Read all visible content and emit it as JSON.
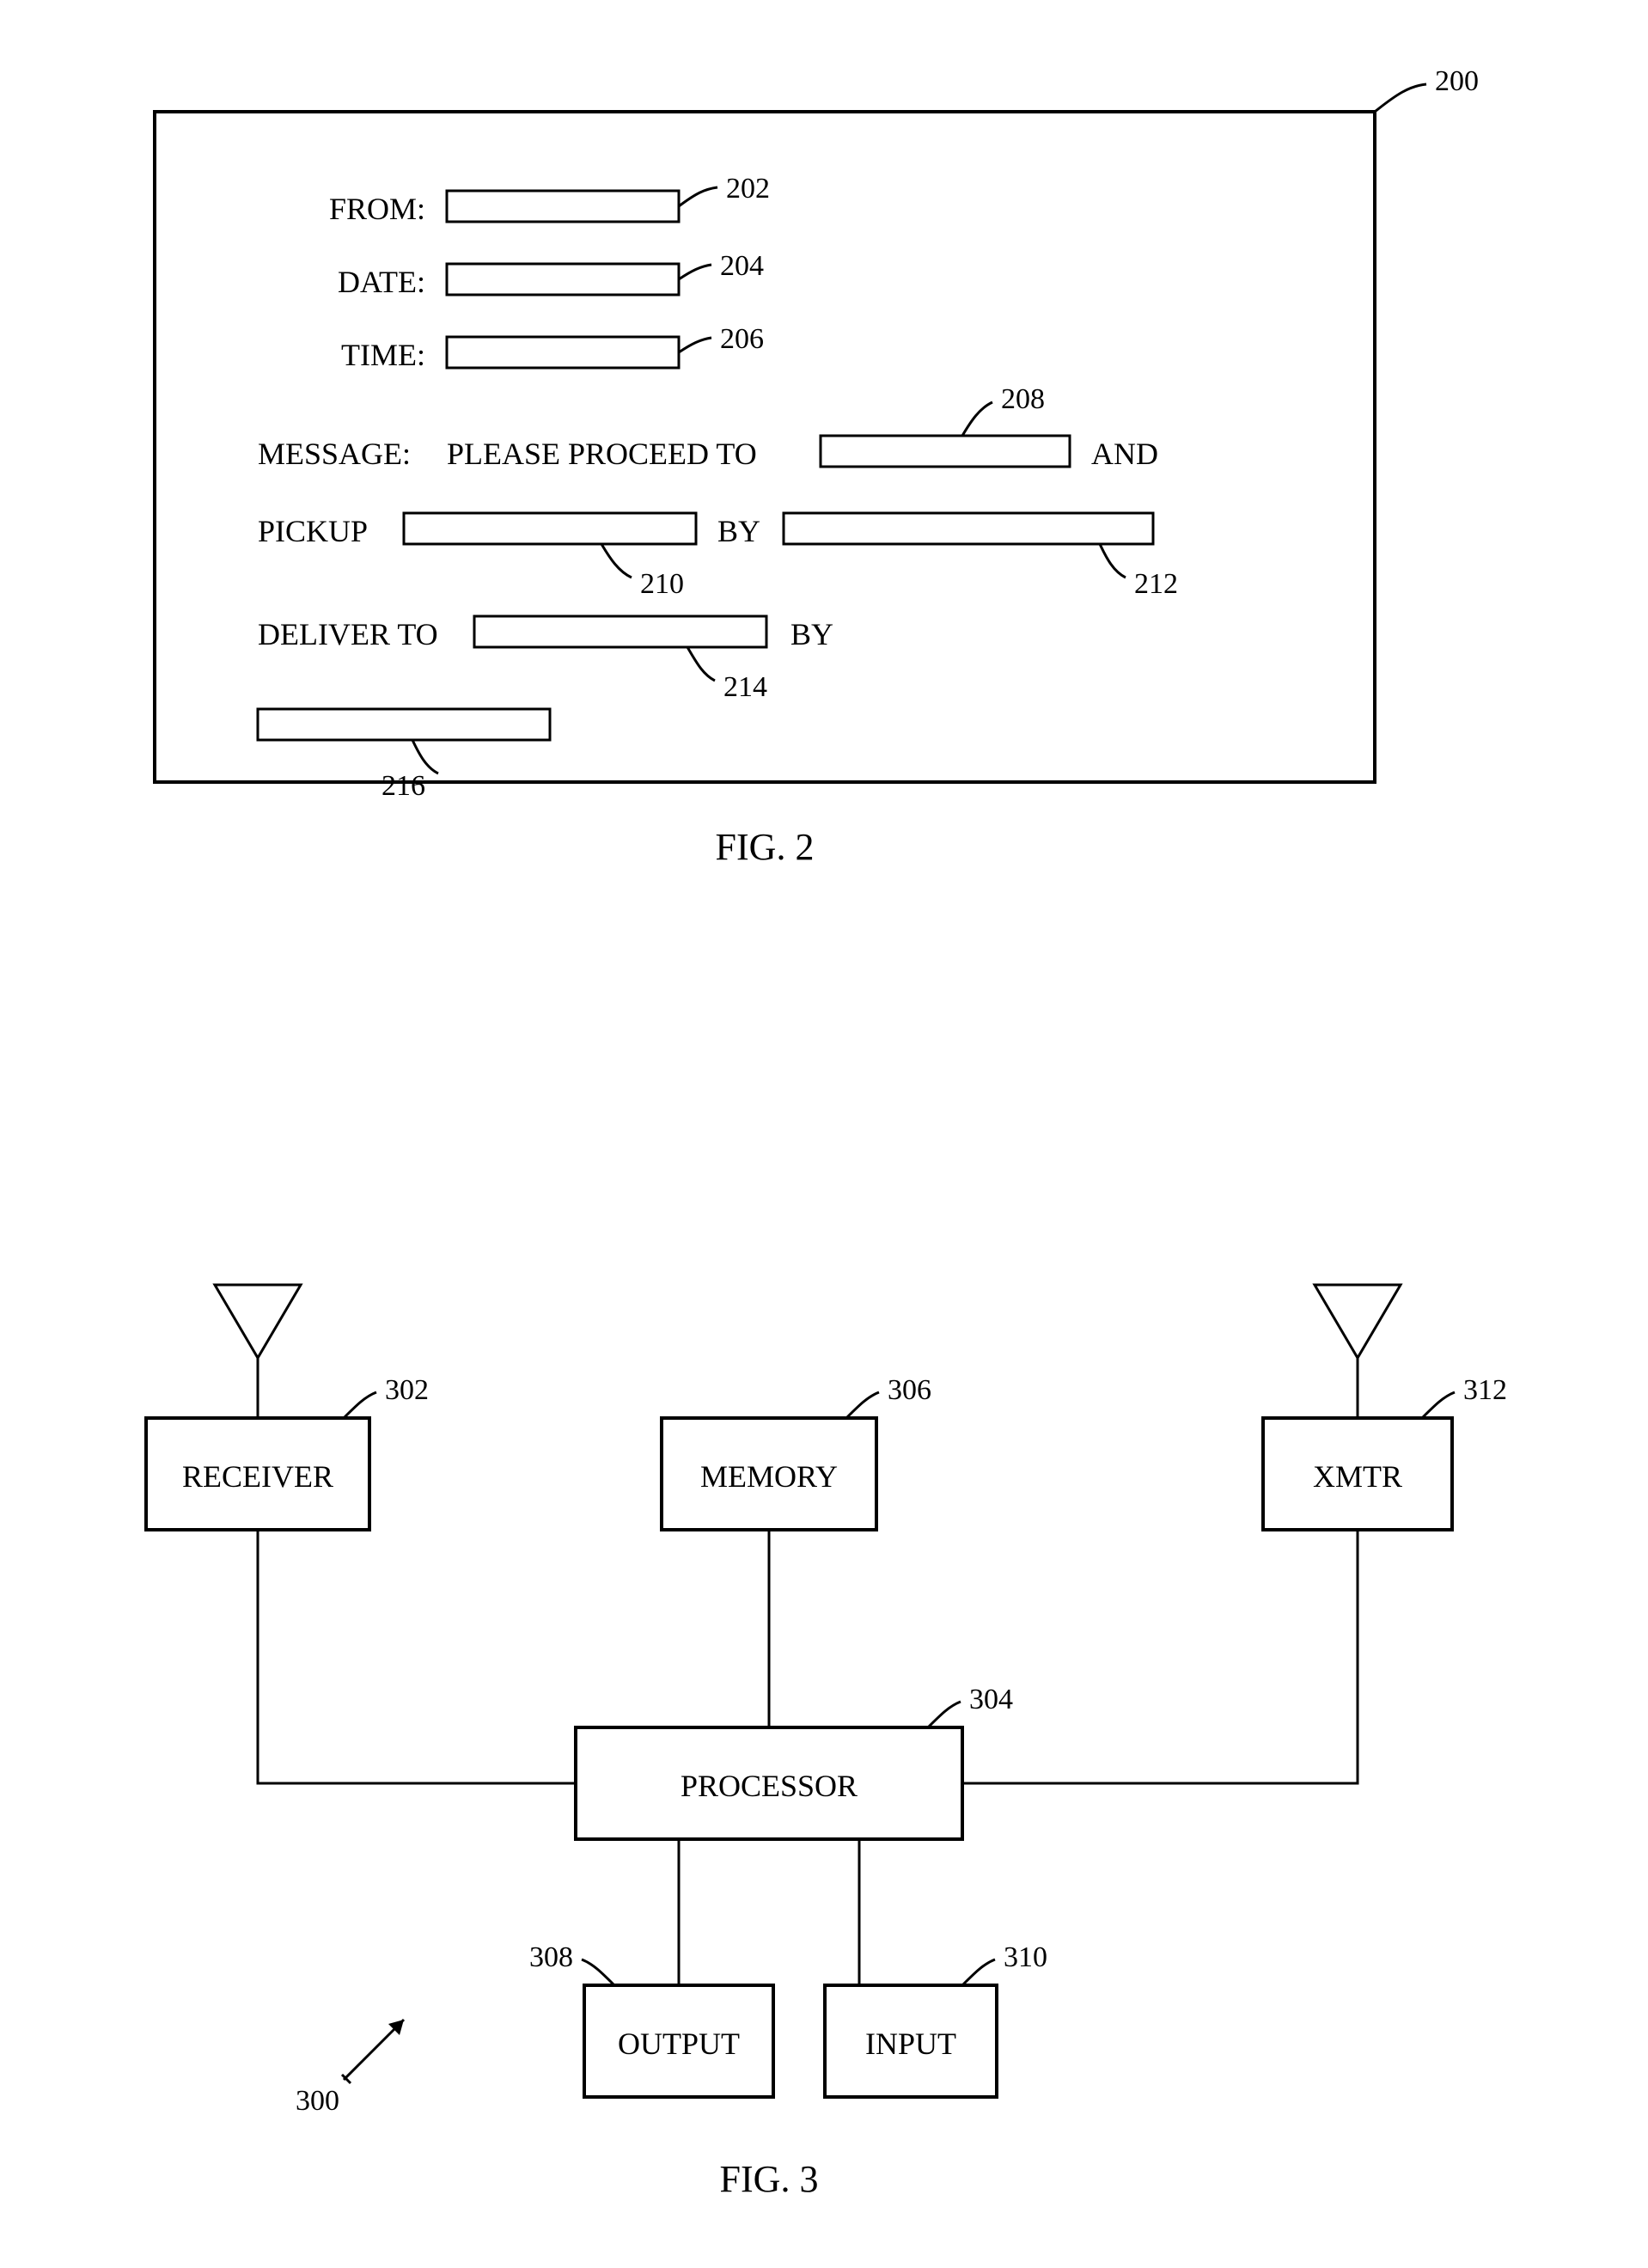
{
  "fig2": {
    "caption": "FIG. 2",
    "ref_main": "200",
    "labels": {
      "from": "FROM:",
      "date": "DATE:",
      "time": "TIME:",
      "message": "MESSAGE:",
      "msg_text_1a": "PLEASE PROCEED TO",
      "msg_text_1b": "AND",
      "msg_text_2a": "PICKUP",
      "msg_text_2b": "BY",
      "msg_text_3a": "DELIVER TO",
      "msg_text_3b": "BY"
    },
    "refs": {
      "from": "202",
      "date": "204",
      "time": "206",
      "proceed_to": "208",
      "pickup": "210",
      "pickup_by": "212",
      "deliver_to": "214",
      "deliver_by": "216"
    }
  },
  "fig3": {
    "caption": "FIG. 3",
    "ref_main": "300",
    "blocks": {
      "receiver": "RECEIVER",
      "memory": "MEMORY",
      "xmtr": "XMTR",
      "processor": "PROCESSOR",
      "output": "OUTPUT",
      "input": "INPUT"
    },
    "refs": {
      "receiver": "302",
      "memory": "306",
      "xmtr": "312",
      "processor": "304",
      "output": "308",
      "input": "310"
    }
  }
}
